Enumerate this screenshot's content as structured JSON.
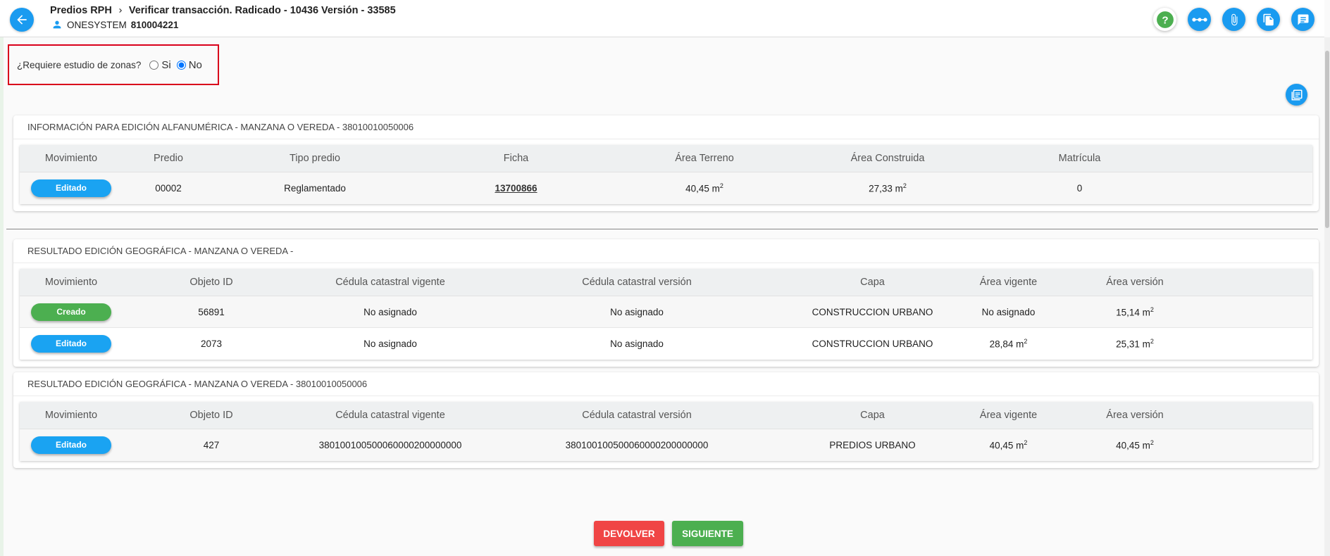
{
  "header": {
    "breadcrumb_root": "Predios RPH",
    "breadcrumb_current": "Verificar transacción. Radicado - 10436 Versión - 33585",
    "user_name": "ONESYSTEM",
    "user_code": "810004221"
  },
  "zone_study": {
    "question": "¿Requiere estudio de zonas?",
    "option_yes": "Si",
    "option_no": "No",
    "selected": "No"
  },
  "alfanumerica": {
    "title": "INFORMACIÓN PARA EDICIÓN ALFANUMÉRICA - MANZANA O VEREDA - 38010010050006",
    "columns": [
      "Movimiento",
      "Predio",
      "Tipo predio",
      "Ficha",
      "Área Terreno",
      "Área Construida",
      "Matrícula"
    ],
    "rows": [
      {
        "movimiento": "Editado",
        "predio": "00002",
        "tipo_predio": "Reglamentado",
        "ficha": "13700866",
        "area_terreno": "40,45 m",
        "area_construida": "27,33 m",
        "matricula": "0"
      }
    ]
  },
  "geo_1": {
    "title": "RESULTADO EDICIÓN GEOGRÁFICA - MANZANA O VEREDA -",
    "columns": [
      "Movimiento",
      "Objeto ID",
      "Cédula catastral vigente",
      "Cédula catastral versión",
      "Capa",
      "Área vigente",
      "Área versión"
    ],
    "rows": [
      {
        "movimiento": "Creado",
        "objeto_id": "56891",
        "cedula_vigente": "No asignado",
        "cedula_version": "No asignado",
        "capa": "CONSTRUCCION URBANO",
        "area_vigente": "No asignado",
        "area_version": "15,14 m"
      },
      {
        "movimiento": "Editado",
        "objeto_id": "2073",
        "cedula_vigente": "No asignado",
        "cedula_version": "No asignado",
        "capa": "CONSTRUCCION URBANO",
        "area_vigente": "28,84 m",
        "area_version": "25,31 m"
      }
    ]
  },
  "geo_2": {
    "title": "RESULTADO EDICIÓN GEOGRÁFICA - MANZANA O VEREDA - 38010010050006",
    "columns": [
      "Movimiento",
      "Objeto ID",
      "Cédula catastral vigente",
      "Cédula catastral versión",
      "Capa",
      "Área vigente",
      "Área versión"
    ],
    "rows": [
      {
        "movimiento": "Editado",
        "objeto_id": "427",
        "cedula_vigente": "380100100500060000200000000",
        "cedula_version": "380100100500060000200000000",
        "capa": "PREDIOS URBANO",
        "area_vigente": "40,45 m",
        "area_version": "40,45 m"
      }
    ]
  },
  "area_unit_exponent": "2",
  "buttons": {
    "devolver": "DEVOLVER",
    "siguiente": "SIGUIENTE"
  },
  "icons": [
    "arrow-left-icon",
    "chevron-right-icon",
    "person-icon",
    "help-icon",
    "more-horizontal-icon",
    "paperclip-icon",
    "document-copy-icon",
    "notes-icon",
    "fullscreen-icon"
  ],
  "colors": {
    "accent_blue": "#1a9bf0",
    "edited_pill": "#1aa3f2",
    "created_pill": "#4caf50",
    "help_green": "#4caf50",
    "danger_red": "#f04545",
    "highlight_border": "#d9001b"
  }
}
